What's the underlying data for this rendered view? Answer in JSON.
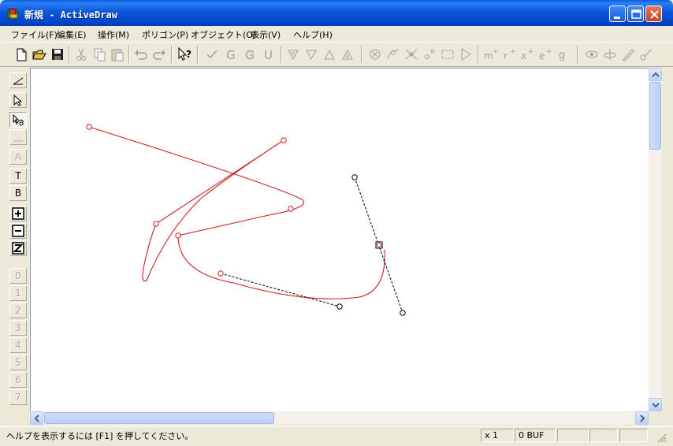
{
  "window": {
    "title": "新規 - ActiveDraw"
  },
  "menu": [
    {
      "label": "ファイル(F)"
    },
    {
      "label": "編集(E)"
    },
    {
      "label": "操作(M)"
    },
    {
      "label": "ポリゴン(P)"
    },
    {
      "label": "オブジェクト(O)"
    },
    {
      "label": "表示(V)"
    },
    {
      "label": "ヘルプ(H)"
    }
  ],
  "toolbar": {
    "icons": [
      "new-file-icon",
      "open-folder-icon",
      "save-icon",
      "cut-icon",
      "copy-icon",
      "paste-icon",
      "undo-icon",
      "redo-icon",
      "context-help-icon",
      "check-icon",
      "g-icon",
      "g-outline-icon",
      "u-icon",
      "triangle-down-filled-icon",
      "triangle-down-icon",
      "triangle-up-icon",
      "triangle-up-filled-icon",
      "circle-x-icon",
      "node-icon",
      "cross-node-icon",
      "point-icon",
      "rectangle-icon",
      "play-icon",
      "m-plus-icon",
      "r-plus-icon",
      "x-plus-icon",
      "e-plus-icon",
      "g-small-icon",
      "eye-icon",
      "rotate-icon",
      "pen-icon",
      "pen-node-icon"
    ]
  },
  "toolbox": {
    "tools": [
      {
        "label": "",
        "icon": "line-tool-icon"
      },
      {
        "label": "",
        "icon": "select-arrow-icon"
      },
      {
        "label": "",
        "icon": "node-edit-icon"
      },
      {
        "label": "",
        "icon": "rect-tool-icon"
      },
      {
        "label": "A",
        "icon": "text-a-icon"
      },
      {
        "label": "T",
        "icon": "text-t-icon"
      },
      {
        "label": "B",
        "icon": "text-b-icon"
      },
      {
        "label": "+",
        "icon": "plus-box-icon"
      },
      {
        "label": "−",
        "icon": "minus-box-icon"
      },
      {
        "label": "Z",
        "icon": "z-box-icon"
      },
      {
        "label": "0",
        "icon": "layer-0-icon"
      },
      {
        "label": "1",
        "icon": "layer-1-icon"
      },
      {
        "label": "2",
        "icon": "layer-2-icon"
      },
      {
        "label": "3",
        "icon": "layer-3-icon"
      },
      {
        "label": "4",
        "icon": "layer-4-icon"
      },
      {
        "label": "5",
        "icon": "layer-5-icon"
      },
      {
        "label": "6",
        "icon": "layer-6-icon"
      },
      {
        "label": "7",
        "icon": "layer-7-icon"
      }
    ]
  },
  "statusbar": {
    "help_text": "ヘルプを表示するには [F1] を押してください。",
    "zoom": "x 1",
    "buffer": "0 BUF"
  },
  "colors": {
    "curve": "#cc2222",
    "guide": "#000000",
    "title_bar": "#0a5fe0"
  }
}
